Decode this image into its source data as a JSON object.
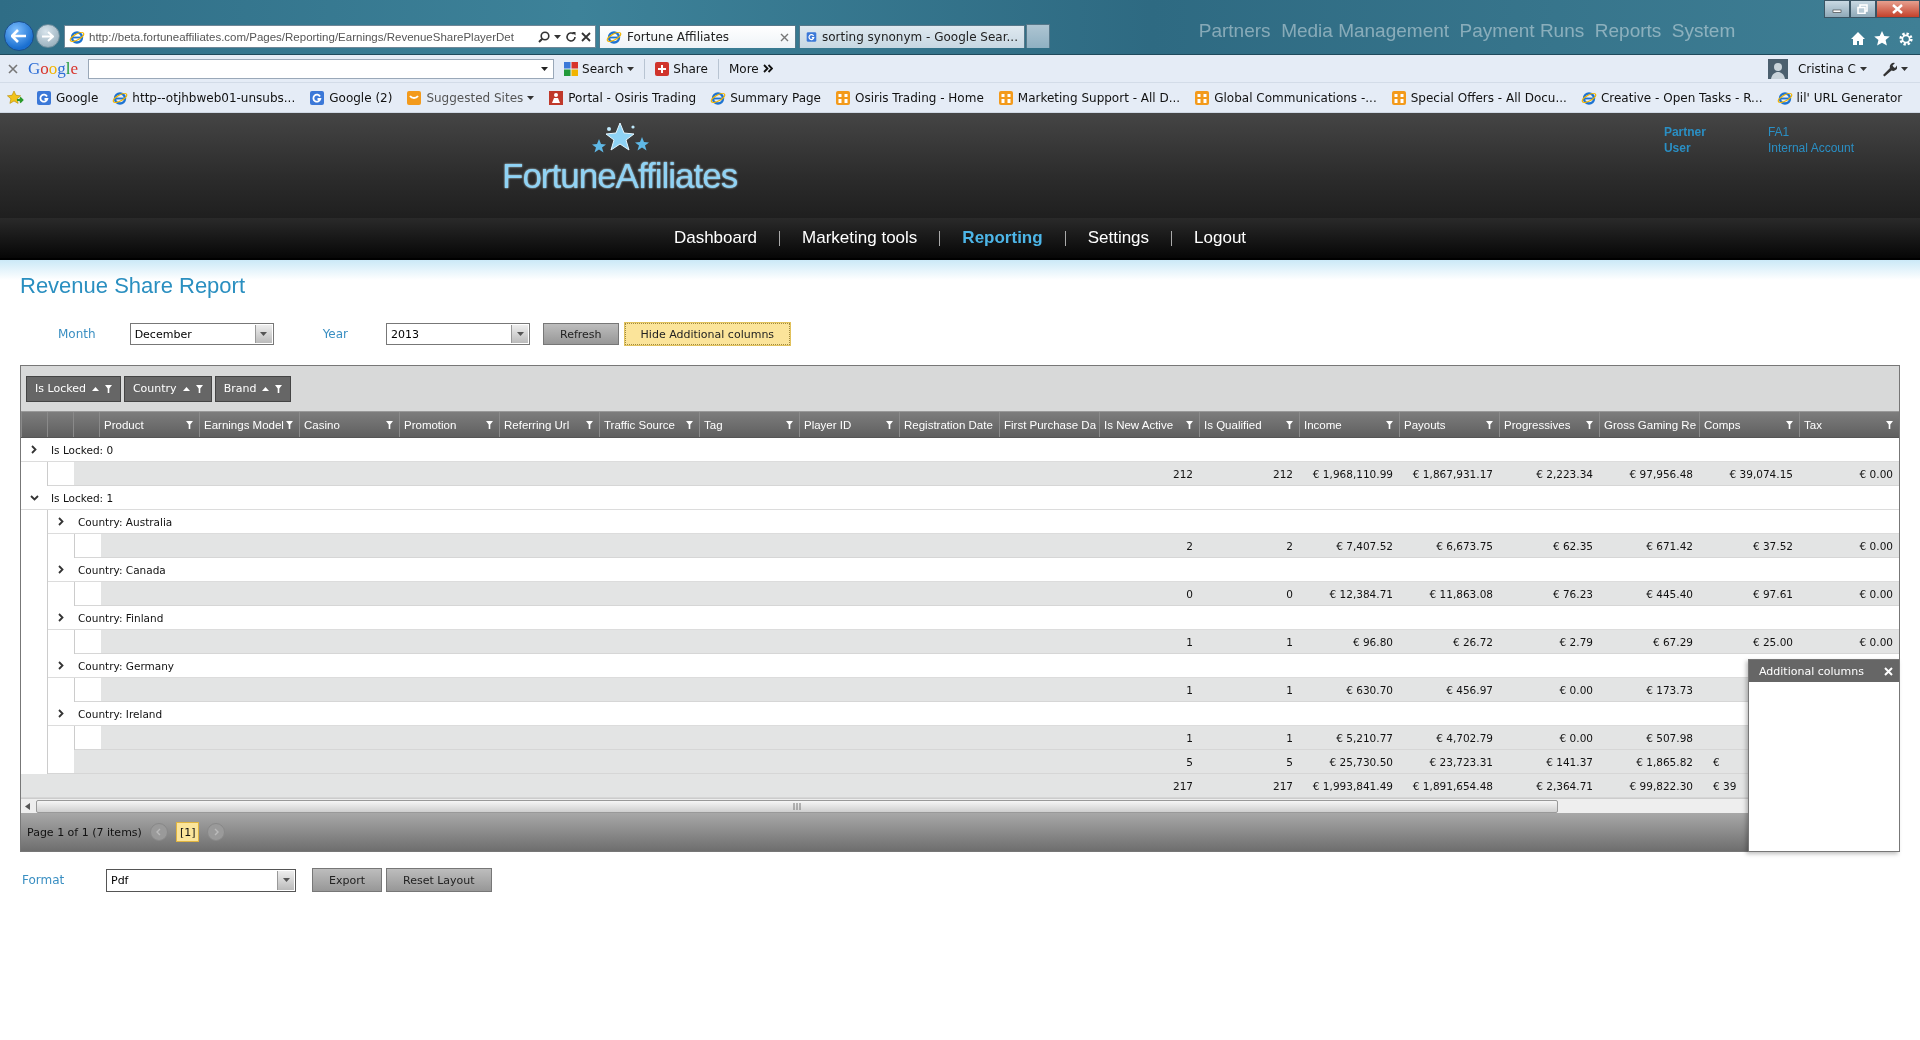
{
  "browser": {
    "address": "http://beta.fortuneaffiliates.com/Pages/Reporting/Earnings/RevenueSharePlayerDet",
    "tabs": [
      {
        "title": "Fortune Affiliates",
        "kind": "ie",
        "selected": true
      },
      {
        "title": "sorting synonym - Google Sear...",
        "kind": "google",
        "selected": false
      }
    ],
    "background_text": "Partners  Media Management  Payment Runs  Reports  System",
    "toolbar": {
      "logo": "Google",
      "search_button": "Search",
      "share_button": "Share",
      "more_button": "More",
      "user": "Cristina C"
    },
    "favorites": [
      {
        "label": "Google",
        "kind": "google",
        "dropdown": false
      },
      {
        "label": "http--otjhbweb01-unsubs...",
        "kind": "ie",
        "dropdown": false
      },
      {
        "label": "Google (2)",
        "kind": "google",
        "dropdown": false
      },
      {
        "label": "Suggested Sites",
        "kind": "suggested",
        "dropdown": true
      },
      {
        "label": "Portal - Osiris Trading",
        "kind": "portal",
        "dropdown": false
      },
      {
        "label": "Summary Page",
        "kind": "ie",
        "dropdown": false
      },
      {
        "label": "Osiris Trading - Home",
        "kind": "sharepoint",
        "dropdown": false
      },
      {
        "label": "Marketing Support - All D...",
        "kind": "sharepoint",
        "dropdown": false
      },
      {
        "label": "Global Communications -...",
        "kind": "sharepoint",
        "dropdown": false
      },
      {
        "label": "Special Offers - All Docu...",
        "kind": "sharepoint",
        "dropdown": false
      },
      {
        "label": "Creative - Open Tasks - R...",
        "kind": "ie",
        "dropdown": false
      },
      {
        "label": "lil' URL Generator",
        "kind": "ie",
        "dropdown": false
      }
    ]
  },
  "site": {
    "logo": "FortuneAffiliates",
    "account": [
      {
        "label": "Partner",
        "value": "FA1"
      },
      {
        "label": "User",
        "value": "Internal Account"
      }
    ],
    "nav": [
      {
        "label": "Dashboard",
        "selected": false
      },
      {
        "label": "Marketing tools",
        "selected": false
      },
      {
        "label": "Reporting",
        "selected": true
      },
      {
        "label": "Settings",
        "selected": false
      },
      {
        "label": "Logout",
        "selected": false
      }
    ]
  },
  "page_title": "Revenue Share Report",
  "filters": {
    "month_label": "Month",
    "month": "December",
    "year_label": "Year",
    "year": "2013",
    "refresh_button": "Refresh",
    "hide_columns_button": "Hide Additional columns"
  },
  "grid": {
    "group_by": [
      "Is Locked",
      "Country",
      "Brand"
    ],
    "columns": [
      {
        "label": "Product",
        "filter": true
      },
      {
        "label": "Earnings Model",
        "filter": true
      },
      {
        "label": "Casino",
        "filter": true
      },
      {
        "label": "Promotion",
        "filter": true
      },
      {
        "label": "Referring Url",
        "filter": true
      },
      {
        "label": "Traffic Source",
        "filter": true
      },
      {
        "label": "Tag",
        "filter": true
      },
      {
        "label": "Player ID",
        "filter": true
      },
      {
        "label": "Registration Date",
        "filter": false
      },
      {
        "label": "First Purchase Da",
        "filter": false
      },
      {
        "label": "Is New Active",
        "filter": true
      },
      {
        "label": "Is Qualified",
        "filter": true
      },
      {
        "label": "Income",
        "filter": true
      },
      {
        "label": "Payouts",
        "filter": true
      },
      {
        "label": "Progressives",
        "filter": true
      },
      {
        "label": "Gross Gaming Re",
        "filter": false
      },
      {
        "label": "Comps",
        "filter": true
      },
      {
        "label": "Tax",
        "filter": true
      }
    ],
    "groups": [
      {
        "label": "Is Locked: 0",
        "expanded": false,
        "totals": {
          "values": [
            "212",
            "212",
            "€ 1,968,110.99",
            "€ 1,867,931.17",
            "€ 2,223.34",
            "€ 97,956.48",
            "€ 39,074.15",
            "€ 0.00"
          ],
          "clipped_last": false
        }
      },
      {
        "label": "Is Locked: 1",
        "expanded": true,
        "children": [
          {
            "label": "Country: Australia",
            "expanded": false,
            "totals": {
              "values": [
                "2",
                "2",
                "€ 7,407.52",
                "€ 6,673.75",
                "€ 62.35",
                "€ 671.42",
                "€ 37.52",
                "€ 0.00"
              ],
              "clipped_last": false
            }
          },
          {
            "label": "Country: Canada",
            "expanded": false,
            "totals": {
              "values": [
                "0",
                "0",
                "€ 12,384.71",
                "€ 11,863.08",
                "€ 76.23",
                "€ 445.40",
                "€ 97.61",
                "€ 0.00"
              ],
              "clipped_last": false
            }
          },
          {
            "label": "Country: Finland",
            "expanded": false,
            "totals": {
              "values": [
                "1",
                "1",
                "€ 96.80",
                "€ 26.72",
                "€ 2.79",
                "€ 67.29",
                "€ 25.00",
                "€ 0.00"
              ],
              "clipped_last": false
            }
          },
          {
            "label": "Country: Germany",
            "expanded": false,
            "totals": {
              "values": [
                "1",
                "1",
                "€ 630.70",
                "€ 456.97",
                "€ 0.00",
                "€ 173.73"
              ],
              "clipped_last": false
            }
          },
          {
            "label": "Country: Ireland",
            "expanded": false,
            "totals": {
              "values": [
                "1",
                "1",
                "€ 5,210.77",
                "€ 4,702.79",
                "€ 0.00",
                "€ 507.98"
              ],
              "clipped_last": false
            }
          }
        ],
        "totals": {
          "values": [
            "5",
            "5",
            "€ 25,730.50",
            "€ 23,723.31",
            "€ 141.37",
            "€ 1,865.82",
            "€"
          ],
          "clipped_last": true
        }
      }
    ],
    "grand_totals": {
      "values": [
        "217",
        "217",
        "€ 1,993,841.49",
        "€ 1,891,654.48",
        "€ 2,364.71",
        "€ 99,822.30",
        "€ 39"
      ],
      "clipped_last": true
    },
    "pager": {
      "summary": "Page 1 of 1 (7 items)",
      "pages": [
        {
          "label": "[1]",
          "selected": true
        }
      ]
    },
    "popup": {
      "title": "Additional columns"
    }
  },
  "export": {
    "format_label": "Format",
    "format": "Pdf",
    "export_button": "Export",
    "reset_button": "Reset Layout"
  }
}
